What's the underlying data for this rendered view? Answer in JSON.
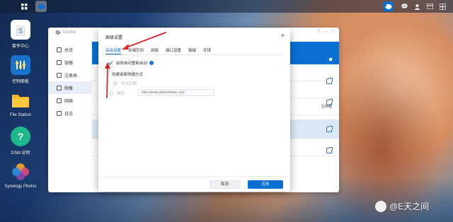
{
  "desktop": {
    "icons": [
      {
        "label": "套件中心",
        "color": "#ffffff"
      },
      {
        "label": "控制面板",
        "color": "#1a73c8"
      },
      {
        "label": "File Station",
        "color": "#f5b521"
      },
      {
        "label": "DSM 说明",
        "color": "#1fb88c"
      },
      {
        "label": "Synology Photos",
        "color": "#e24f7a"
      }
    ]
  },
  "docker_window": {
    "title": "Docker",
    "nav": [
      {
        "label": "总览"
      },
      {
        "label": "容器"
      },
      {
        "label": "注册表"
      },
      {
        "label": "映像"
      },
      {
        "label": "网络"
      },
      {
        "label": "日志"
      }
    ],
    "active_nav": 3,
    "row_note": "应用程"
  },
  "modal": {
    "title": "高级设置",
    "close_icon": "close-icon",
    "tabs": [
      "高级设置",
      "存储空间",
      "网络",
      "端口设置",
      "链接",
      "环境"
    ],
    "active_tab": 0,
    "auto_restart_label": "启用自动重新启动",
    "auto_restart_checked": true,
    "shortcut_section_label": "创建桌面快捷方式",
    "radio_status_page_label": "状态页面",
    "radio_webpage_label": "网页",
    "url_placeholder": "http://www.yitianzhijian.xyz/",
    "cancel_label": "取消",
    "apply_label": "应用"
  },
  "watermark": {
    "text": "@E天之间"
  },
  "colors": {
    "accent": "#0b6fd1",
    "annotation": "#e02424"
  }
}
